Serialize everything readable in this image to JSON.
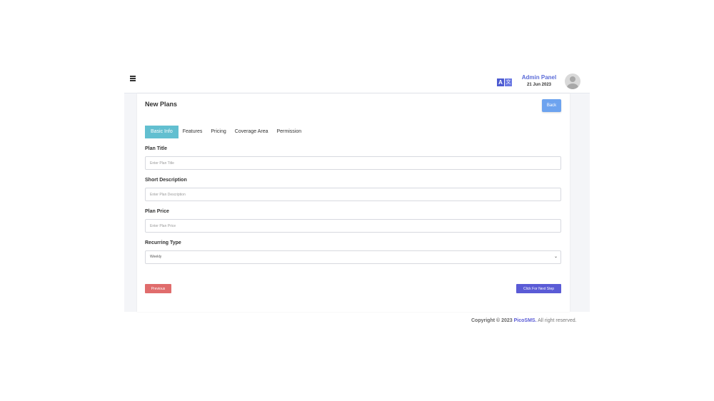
{
  "header": {
    "admin_title": "Admin Panel",
    "date": "21 Jun 2023",
    "lang_icon_left": "A",
    "lang_icon_right": "文"
  },
  "page": {
    "title": "New Plans",
    "back_label": "Back"
  },
  "tabs": [
    {
      "label": "Basic Info",
      "active": true
    },
    {
      "label": "Features",
      "active": false
    },
    {
      "label": "Pricing",
      "active": false
    },
    {
      "label": "Coverage Area",
      "active": false
    },
    {
      "label": "Permission",
      "active": false
    }
  ],
  "form": {
    "plan_title": {
      "label": "Plan Title",
      "placeholder": "Enter Plan Title",
      "value": ""
    },
    "short_description": {
      "label": "Short Description",
      "placeholder": "Enter Plan Description",
      "value": ""
    },
    "plan_price": {
      "label": "Plan Price",
      "placeholder": "Enter Plan Price",
      "value": ""
    },
    "recurring_type": {
      "label": "Recurring Type",
      "selected": "Weekly"
    }
  },
  "actions": {
    "previous_label": "Previous",
    "next_label": "Click For Next Step"
  },
  "footer": {
    "prefix": "Copyright © 2023",
    "brand": "PicoSMS.",
    "suffix": "All right reserved."
  },
  "colors": {
    "accent": "#5a5bd6",
    "tab_active": "#62bfd0",
    "back_button": "#6da3ef",
    "previous_button": "#e06c6c"
  }
}
